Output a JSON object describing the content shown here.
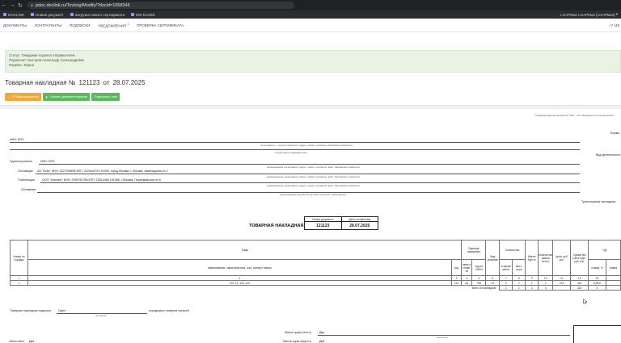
{
  "browser": {
    "url": "pdoc.doclink.ru/Tovtorg/Modify/?docid=1658246",
    "bookmarks": [
      "DOCLINK",
      "Новый документ",
      "Загрузка нового сертификата",
      "EDI Doclink"
    ],
    "user": "LOAPMan LOAPMan [LOAPMan]"
  },
  "appnav": {
    "items": [
      "ДОКУМЕНТЫ",
      "КОНТРАГЕНТЫ",
      "ПОДПИСКИ",
      "УВЕДОМЛЕНИЯ",
      "ПРОВЕРКА СЕРТИФИКАТА"
    ],
    "notifications_badge": "1",
    "phone": "+7 (49"
  },
  "notice": {
    "line1": "Статус: Ожидание подписи отправителем",
    "line2": "Подписант: Быстров Александр Александрович",
    "line3": "Подпись: Верна"
  },
  "header": {
    "title": "Товарная накладная №",
    "number": "121123",
    "from": "от",
    "date": "28.07.2025"
  },
  "actions": {
    "edit": "К Редактированию",
    "download": "Скачать документ/подпись",
    "sign": "Подписать/ лист"
  },
  "doc": {
    "unified_form": "Унифицированная форма № ТОРГ - 12 Утверждена постановлением",
    "form_okud": "Форма",
    "inn_kpp": "ИНН: КПП:",
    "org_caption": "организация — грузоотправитель, адрес, номер телефона, банковские реквизиты",
    "subdivision": "Структурное подразделение",
    "activity": "Вид деятельности",
    "consignee_label": "Грузополучатель",
    "consignee_value": "ИНН: КПП:",
    "org_caption2": "наименование организации, адрес, номер телефона, факс, банковские реквизиты",
    "supplier_label": "Поставщик",
    "supplier_value": "АО \"Бейс\" ИНН: 3227408896 КПП: 322644Г29 191900, город Москва, г. Москва, Авангардная ул 2",
    "payer_label": "Плательщик",
    "payer_value": "ООО \"Алескин\" ИНН: 2955782788 КПП: 22614465 191986, г Москва, Первомайская пл 6",
    "basis_label": "Основание",
    "basis_caption": "наименование документа (договор, контракт, заказ-наряд)",
    "transport": "Транспортная накладная",
    "doc_title": "ТОВАРНАЯ НАКЛАДНАЯ",
    "doc_number_label": "Номер документа",
    "doc_date_label": "Дата составления",
    "doc_number": "121123",
    "doc_date": "28.07.2025",
    "columns": {
      "num": "Номер по порядку",
      "goods": "Товар",
      "goods_sub": "наименование, характеристика, сорт, артикул товара",
      "code": "код",
      "unit": "Единица измерения",
      "unit_name": "наим-е-нован-ие",
      "unit_okei": "код по ОКЕИ",
      "pack": "Вид упаковки",
      "qty": "Количество",
      "qty_place": "в одном месте",
      "qty_pieces": "мест, штук",
      "gross": "Масса брутто",
      "net": "Количество (масса нетто)",
      "price": "Цена, руб. коп.",
      "sum": "Сумма без учета НДС, руб. коп.",
      "vat": "НД",
      "vat_rate": "ставка, %",
      "vat_sum": "сумма"
    },
    "col_numbers": [
      "1",
      "2",
      "3",
      "4",
      "5",
      "6",
      "7",
      "8",
      "9",
      "10",
      "11",
      "12",
      "13"
    ],
    "row": {
      "num": "1",
      "name": "123, 12, 123, 123",
      "code": "123",
      "unit": "шт",
      "okei": "796",
      "pack": "12",
      "place": "2",
      "pieces": "2",
      "gross": "2",
      "net": "2",
      "price": "212",
      "sum": "424",
      "rate": "6,99%"
    },
    "total_label": "Всего по накладной",
    "totals": [
      "2",
      "2",
      "2",
      "4",
      "424",
      "4"
    ],
    "attach_label": "Товарная накладная содержит",
    "attach_value": "Один",
    "attach_caption": "прописью",
    "attach_suffix": "порядковых номеров записей",
    "cargo_mass": "Масса груза (нетто)",
    "cargo_mass_value": "Два",
    "cargo_caption": "прописью",
    "cargo_gross": "Масса груза (брутто)",
    "cargo_gross_value": "Два",
    "places": "Всего мест",
    "places_value": "Два"
  }
}
